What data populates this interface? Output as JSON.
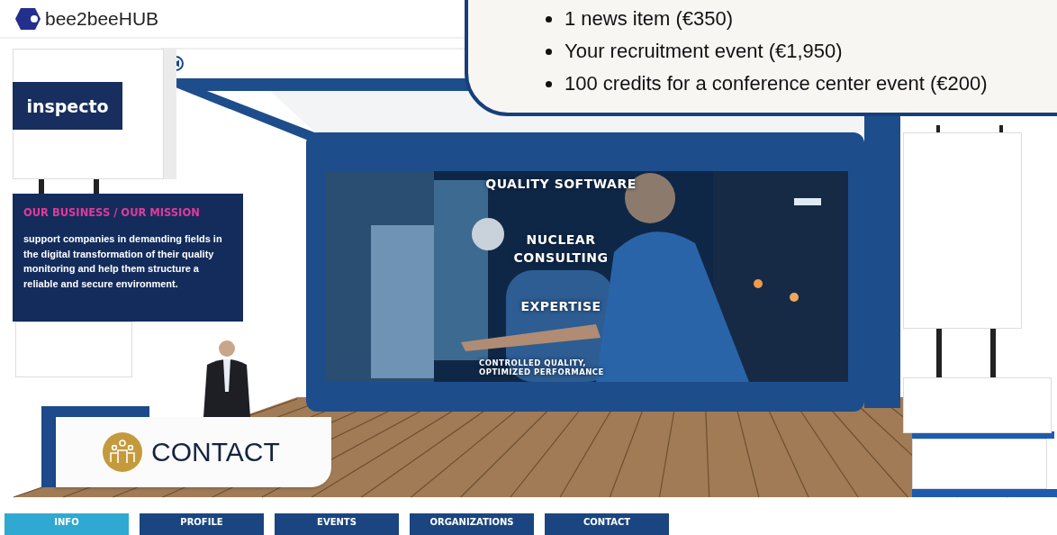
{
  "header": {
    "logo_text": "bee2beeHUB"
  },
  "notice": {
    "items": [
      "1 news item (€350)",
      "Your recruitment event (€1,950)",
      "100 credits for a conference center event (€200)"
    ]
  },
  "booth": {
    "company_logo": "inspecto",
    "mission": {
      "title": "OUR BUSINESS / OUR MISSION",
      "body": "support companies in demanding fields in the digital transformation of their quality monitoring and help them structure a reliable and secure environment."
    },
    "banner_texts": [
      "QUALITY SOFTWARE",
      "NUCLEAR CONSULTING",
      "EXPERTISE",
      "CONTROLLED QUALITY, OPTIMIZED PERFORMANCE"
    ],
    "desk_label": "CONTACT"
  },
  "tabs": [
    {
      "label": "INFO",
      "selected": true
    },
    {
      "label": "PROFILE",
      "selected": false
    },
    {
      "label": "EVENTS",
      "selected": false
    },
    {
      "label": "ORGANIZATIONS",
      "selected": false
    },
    {
      "label": "CONTACT",
      "selected": false
    }
  ]
}
